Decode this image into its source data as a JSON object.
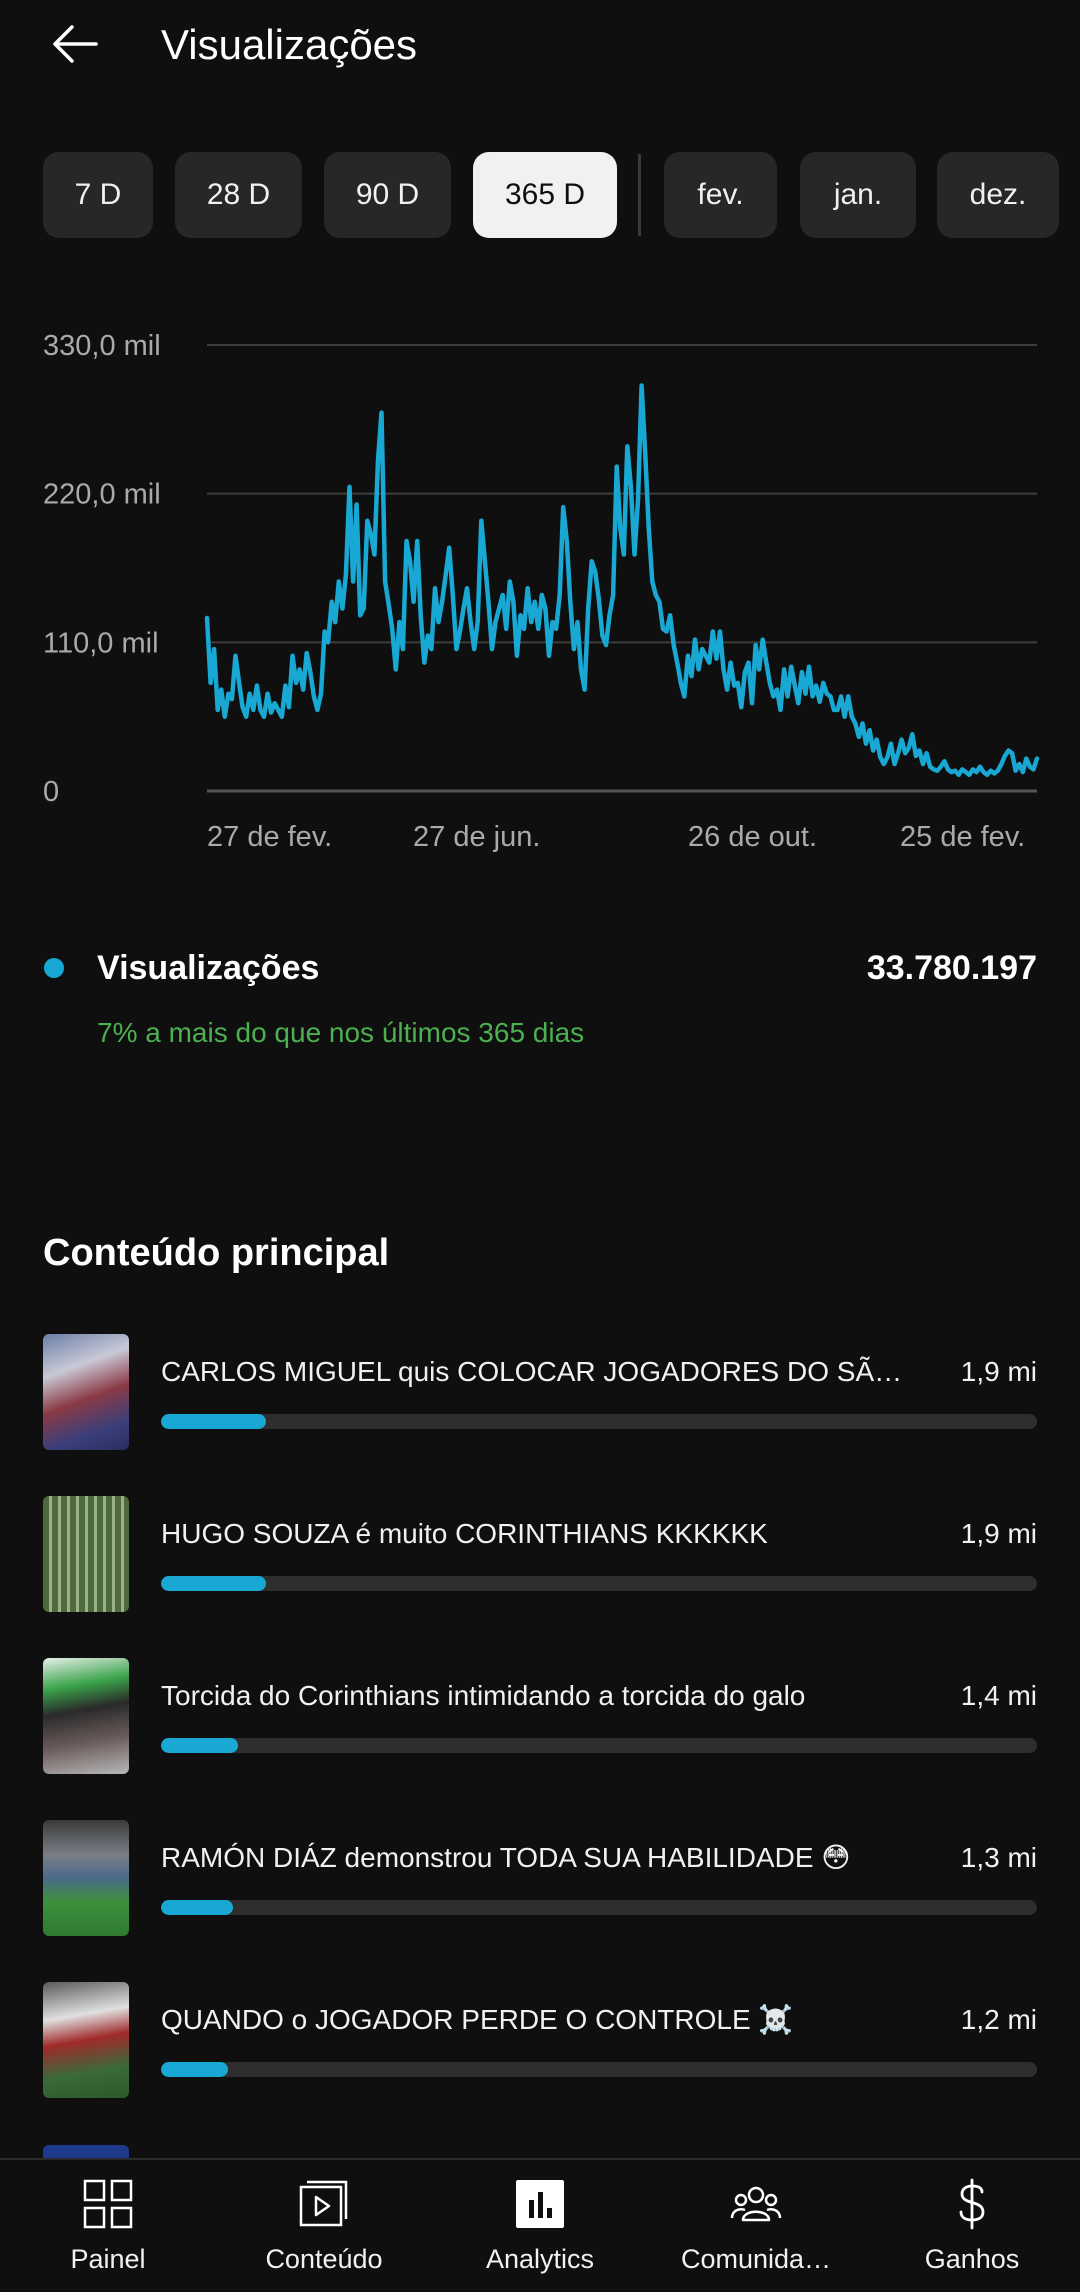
{
  "header": {
    "title": "Visualizações",
    "back_icon": "arrow-left-icon"
  },
  "period_chips": [
    {
      "label": "7 D",
      "selected": false
    },
    {
      "label": "28 D",
      "selected": false
    },
    {
      "label": "90 D",
      "selected": false
    },
    {
      "label": "365 D",
      "selected": true
    },
    {
      "label": "fev.",
      "selected": false
    },
    {
      "label": "jan.",
      "selected": false
    },
    {
      "label": "dez.",
      "selected": false
    }
  ],
  "chart_data": {
    "type": "line",
    "y_tick_labels": [
      "330,0 mil",
      "220,0 mil",
      "110,0 mil",
      "0"
    ],
    "y_ticks": [
      330000,
      220000,
      110000,
      0
    ],
    "ylim": [
      0,
      330000
    ],
    "x_tick_labels": [
      "27 de fev.",
      "27 de jun.",
      "26 de out.",
      "25 de fev."
    ],
    "grid": true,
    "line_color": "#18a8d3",
    "series": [
      {
        "values": [
          128000,
          80000,
          105000,
          60000,
          75000,
          55000,
          72000,
          68000,
          100000,
          80000,
          62000,
          55000,
          72000,
          60000,
          78000,
          60000,
          55000,
          72000,
          58000,
          65000,
          60000,
          55000,
          78000,
          62000,
          100000,
          80000,
          90000,
          75000,
          102000,
          88000,
          70000,
          60000,
          72000,
          118000,
          110000,
          140000,
          125000,
          155000,
          135000,
          160000,
          225000,
          155000,
          212000,
          130000,
          135000,
          200000,
          190000,
          175000,
          245000,
          280000,
          155000,
          138000,
          120000,
          90000,
          125000,
          105000,
          185000,
          170000,
          140000,
          185000,
          130000,
          95000,
          115000,
          105000,
          150000,
          125000,
          140000,
          160000,
          180000,
          145000,
          105000,
          118000,
          135000,
          150000,
          125000,
          105000,
          125000,
          200000,
          170000,
          140000,
          105000,
          125000,
          135000,
          145000,
          120000,
          155000,
          140000,
          100000,
          130000,
          120000,
          150000,
          125000,
          140000,
          120000,
          145000,
          135000,
          100000,
          125000,
          120000,
          145000,
          210000,
          185000,
          140000,
          105000,
          125000,
          90000,
          75000,
          135000,
          170000,
          162000,
          142000,
          115000,
          108000,
          130000,
          145000,
          240000,
          195000,
          175000,
          255000,
          225000,
          175000,
          215000,
          300000,
          250000,
          195000,
          155000,
          145000,
          140000,
          120000,
          118000,
          130000,
          108000,
          95000,
          80000,
          70000,
          100000,
          85000,
          112000,
          90000,
          105000,
          100000,
          95000,
          118000,
          98000,
          118000,
          90000,
          75000,
          95000,
          78000,
          80000,
          62000,
          88000,
          95000,
          65000,
          108000,
          90000,
          112000,
          95000,
          80000,
          70000,
          75000,
          60000,
          90000,
          70000,
          92000,
          78000,
          65000,
          88000,
          72000,
          92000,
          70000,
          78000,
          66000,
          80000,
          72000,
          70000,
          60000,
          60000,
          70000,
          55000,
          70000,
          55000,
          50000,
          40000,
          50000,
          35000,
          45000,
          30000,
          38000,
          25000,
          20000,
          25000,
          35000,
          20000,
          28000,
          38000,
          28000,
          32000,
          42000,
          26000,
          30000,
          20000,
          28000,
          18000,
          16000,
          15000,
          18000,
          22000,
          16000,
          14000,
          15000,
          12000,
          16000,
          14000,
          12000,
          16000,
          14000,
          18000,
          14000,
          12000,
          15000,
          13000,
          15000,
          20000,
          26000,
          30000,
          28000,
          15000,
          20000,
          14000,
          24000,
          18000,
          16000,
          24000
        ]
      }
    ]
  },
  "summary": {
    "label": "Visualizações",
    "value": "33.780.197",
    "change": "7% a mais do que nos últimos 365 dias",
    "dot_color": "#18a8d3",
    "change_color": "#4caf50"
  },
  "top_content": {
    "title": "Conteúdo principal",
    "items": [
      {
        "title": "CARLOS MIGUEL quis COLOCAR JOGADORES DO SÃO…",
        "value": "1,9 mi",
        "bar_fraction": 0.12
      },
      {
        "title": "HUGO SOUZA é muito CORINTHIANS KKKKKK",
        "value": "1,9 mi",
        "bar_fraction": 0.12
      },
      {
        "title": "Torcida do Corinthians intimidando a torcida do galo",
        "value": "1,4 mi",
        "bar_fraction": 0.088
      },
      {
        "title": "RAMÓN DIÁZ demonstrou TODA SUA HABILIDADE 😳",
        "value": "1,3 mi",
        "bar_fraction": 0.082
      },
      {
        "title": "QUANDO o JOGADOR PERDE O CONTROLE ☠️",
        "value": "1,2 mi",
        "bar_fraction": 0.077
      }
    ]
  },
  "bottom_nav": [
    {
      "label": "Painel",
      "icon": "dashboard-icon"
    },
    {
      "label": "Conteúdo",
      "icon": "content-icon"
    },
    {
      "label": "Analytics",
      "icon": "analytics-icon",
      "active": true
    },
    {
      "label": "Comunida…",
      "icon": "community-icon"
    },
    {
      "label": "Ganhos",
      "icon": "dollar-icon"
    }
  ]
}
